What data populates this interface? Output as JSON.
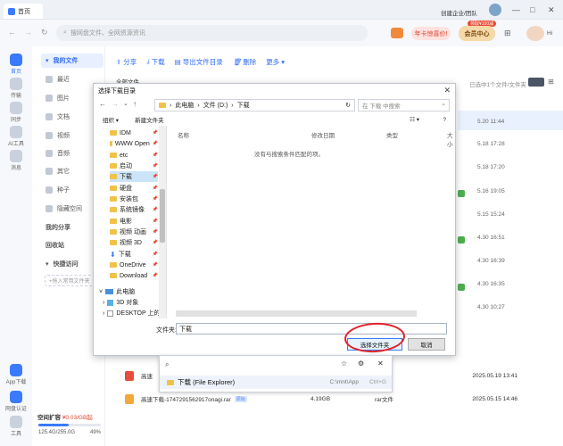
{
  "topbar": {
    "home_tab": "首页",
    "org_link": "创建企业/团队",
    "controls": [
      "—",
      "□",
      "✕"
    ]
  },
  "navbar": {
    "search_placeholder": "搜网盘文件、全网资源资讯",
    "promo": "年卡惊喜价!",
    "vip_badge": "领取¥100减",
    "vip": "会员中心",
    "greeting": "Hi"
  },
  "rail": [
    {
      "label": "首页"
    },
    {
      "label": "传输"
    },
    {
      "label": "同步"
    },
    {
      "label": "AI工具"
    },
    {
      "label": "消息"
    },
    {
      "label": "App下载"
    },
    {
      "label": "网盘认证"
    },
    {
      "label": "工具"
    }
  ],
  "sidebar": {
    "my_files": "我的文件",
    "items": [
      "最近",
      "图片",
      "文档",
      "视频",
      "音频",
      "其它",
      "种子",
      "隐藏空间"
    ],
    "my_share": "我的分享",
    "recycle": "回收站",
    "quick_access": "快捷访问",
    "quick_placeholder": "+拖入常用文件夹",
    "storage_label": "空间扩容",
    "storage_price": "¥0.03/GB起",
    "storage_used": "125.4G/255.0G",
    "storage_pct": "49%",
    "storage_fraction": 0.49
  },
  "main": {
    "toolbar": [
      "分享",
      "下载",
      "导出文件目录",
      "删除",
      "更多"
    ],
    "breadcrumb": "全部文件",
    "selected_info": "已选中1个文件/文件夹",
    "dates": [
      "5.20 11:44",
      "5.18 17:28",
      "5.18 17:20",
      "5.16 19:05",
      "5.15 15:24",
      "4.30 16:51",
      "4.30 16:39",
      "4.30 16:35",
      "4.30 10:27"
    ],
    "rows": [
      {
        "name": "高速",
        "date": "2025.05.19 13:41"
      },
      {
        "name": "高速下载-1747291562917onagi.rar",
        "tag": "原始",
        "size": "4.19GB",
        "type": "rar文件",
        "date": "2025.05.15 14:46"
      }
    ]
  },
  "dialog": {
    "title": "选择下载目录",
    "path": [
      "此电脑",
      "文件 (D:)",
      "下载"
    ],
    "search_placeholder": "在 下载 中搜索",
    "organize": "组织",
    "new_folder": "新建文件夹",
    "tree": [
      {
        "label": "IDM",
        "pin": true
      },
      {
        "label": "WWW Open",
        "pin": true
      },
      {
        "label": "etc",
        "pin": true
      },
      {
        "label": "启动",
        "pin": true
      },
      {
        "label": "下载",
        "pin": true,
        "selected": true
      },
      {
        "label": "硬盘",
        "pin": true
      },
      {
        "label": "安装包",
        "pin": true
      },
      {
        "label": "系统镜像",
        "pin": true
      },
      {
        "label": "电影",
        "pin": true
      },
      {
        "label": "视频 动画",
        "pin": true
      },
      {
        "label": "视频 3D",
        "pin": true
      },
      {
        "label": "下载",
        "pin": true
      },
      {
        "label": "OneDrive",
        "pin": true
      },
      {
        "label": "Download",
        "pin": true
      },
      {
        "label": "此电脑",
        "pin": false
      },
      {
        "label": "3D 对象",
        "pin": false
      },
      {
        "label": "DESKTOP 上的",
        "pin": false
      }
    ],
    "columns": [
      "名称",
      "修改日期",
      "类型",
      "大小"
    ],
    "empty": "没有与搜索条件匹配的项。",
    "folder_label": "文件夹:",
    "folder_value": "下载",
    "select_btn": "选择文件夹",
    "cancel_btn": "取消"
  },
  "quickpop": {
    "item": "下载 (File Explorer)",
    "path": "C:\\mnt\\App",
    "shortcut": "Ctrl+G"
  }
}
